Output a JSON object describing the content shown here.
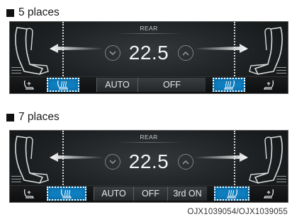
{
  "sections": [
    {
      "label": "5 places",
      "rear_label": "REAR",
      "temperature": "22.5",
      "mode_buttons": [
        "AUTO",
        "OFF"
      ]
    },
    {
      "label": "7 places",
      "rear_label": "REAR",
      "temperature": "22.5",
      "mode_buttons": [
        "AUTO",
        "OFF",
        "3rd ON"
      ]
    }
  ],
  "footer_code": "OJX1039054/OJX1039055",
  "icons": {
    "temp_down": "chevron-down-icon",
    "temp_up": "chevron-up-icon",
    "seat_heat": "seat-heater-icon",
    "seat_vent": "seat-ventilation-icon",
    "airflow": "airflow-arrow-icon"
  },
  "colors": {
    "panel_bg": "#1e2123",
    "active_blue": "#0f7fc0",
    "text_light": "#f4f4f4"
  }
}
